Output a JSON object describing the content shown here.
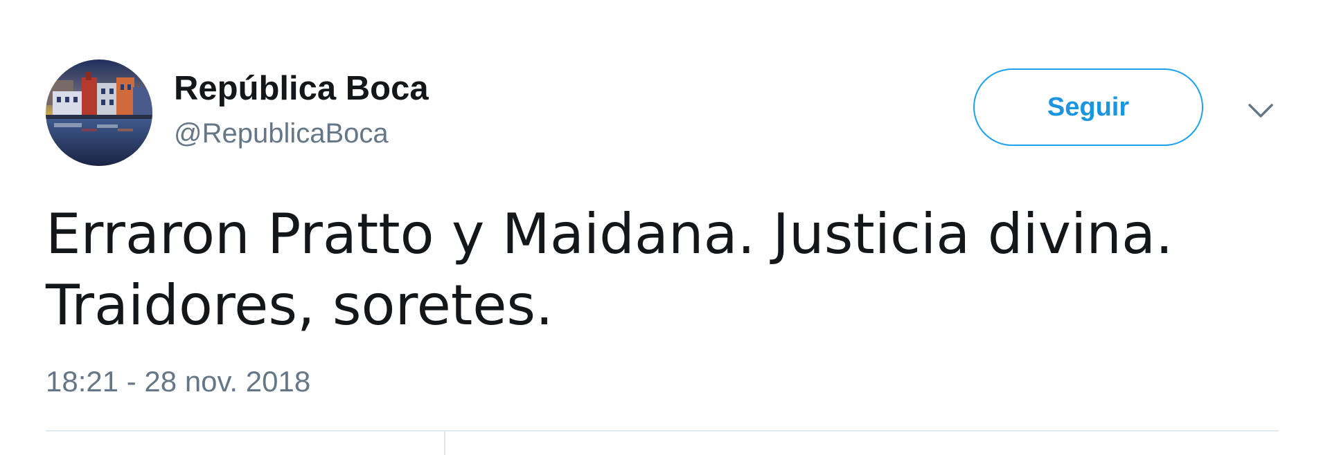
{
  "tweet": {
    "author_name": "República Boca",
    "author_handle": "@RepublicaBoca",
    "follow_label": "Seguir",
    "text_lines": [
      "Erraron Pratto y Maidana. Justicia divina.",
      "Traidores, soretes."
    ],
    "timestamp": "18:21 - 28 nov. 2018",
    "icons": {
      "avatar": "avatar-image",
      "menu": "chevron-down-icon"
    }
  },
  "colors": {
    "accent": "#1da1f2",
    "accent_text": "#1b95e0",
    "text_primary": "#14171a",
    "text_secondary": "#657786",
    "divider": "#e1e8ed"
  }
}
